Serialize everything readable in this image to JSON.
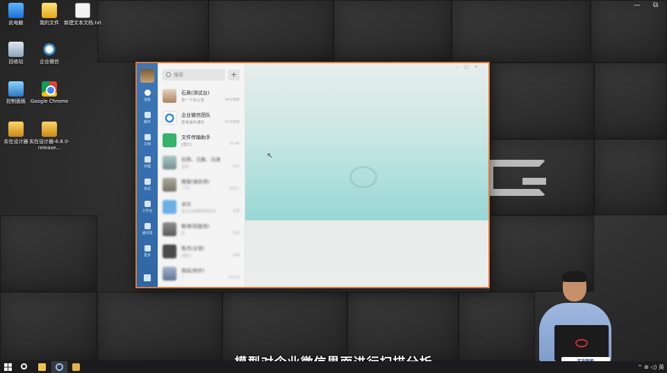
{
  "desktop": {
    "icons": [
      {
        "label": "此电脑"
      },
      {
        "label": "我的文件"
      },
      {
        "label": "新建文本文档.txt"
      },
      {
        "label": "回收站"
      },
      {
        "label": "企业微信"
      },
      {
        "label": "控制面板"
      },
      {
        "label": "Google Chrome"
      },
      {
        "label": "实在设计器"
      },
      {
        "label": "实在设计器-6.8.0-release..."
      }
    ]
  },
  "wecom": {
    "search_placeholder": "搜索",
    "add_button": "+",
    "rail": [
      {
        "label": "消息"
      },
      {
        "label": "邮件"
      },
      {
        "label": "文档"
      },
      {
        "label": "日程"
      },
      {
        "label": "会议"
      },
      {
        "label": "工作台"
      },
      {
        "label": "通讯录"
      },
      {
        "label": "更多"
      }
    ],
    "conversations": [
      {
        "name": "石昊(测试台)",
        "preview": "来一下办公室",
        "time": "44分钟前"
      },
      {
        "name": "企业微信团队",
        "preview": "登录操作通知",
        "time": "52分钟前"
      },
      {
        "name": "文件传输助手",
        "preview": "[图片]",
        "time": "11:42"
      },
      {
        "name": "任燕、王鹏、冯涛",
        "preview": "收到",
        "time": "昨天"
      },
      {
        "name": "框架(保存项)",
        "preview": "1.82",
        "time": "星期六"
      },
      {
        "name": "会议",
        "preview": "会议已被管理员取消",
        "time": "星期"
      },
      {
        "name": "郁涛(回复他)",
        "preview": "好",
        "time": "星期"
      },
      {
        "name": "陈杰(主管)",
        "preview": "[图片]",
        "time": "星期"
      },
      {
        "name": "周延(附件)",
        "preview": "?",
        "time": "8月4日"
      }
    ]
  },
  "subtitle": "模型对企业微信界面进行扫描分析",
  "presenter_stand": "实在智能",
  "taskbar": {
    "tray": "^ ⊗ ◁) 英"
  }
}
